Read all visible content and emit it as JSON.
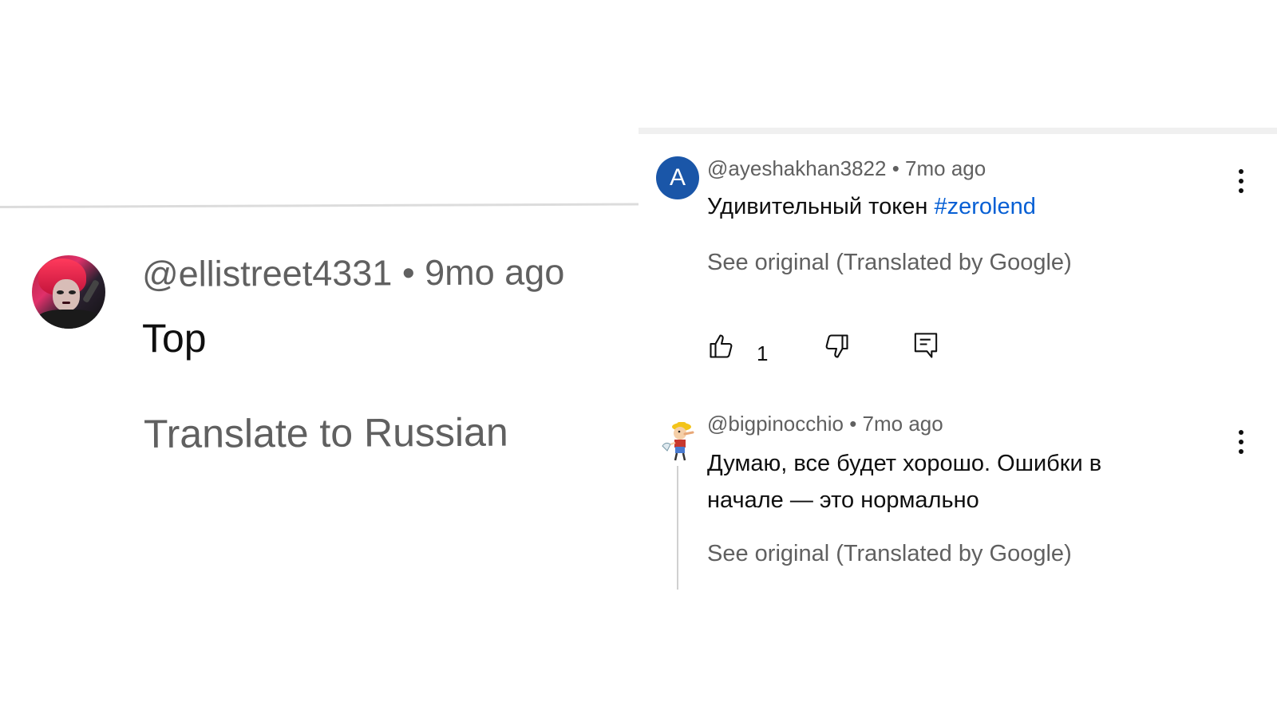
{
  "left_comment": {
    "handle": "@ellistreet4331",
    "separator": "•",
    "time": "9mo ago",
    "text": "Top",
    "translate_label": "Translate to Russian"
  },
  "right_comments": [
    {
      "avatar_letter": "A",
      "avatar_color": "#1a56a8",
      "handle": "@ayeshakhan3822",
      "separator": "•",
      "time": "7mo ago",
      "text": "Удивительный токен ",
      "hashtag": "#zerolend",
      "see_original": "See original (Translated by Google)",
      "like_count": "1"
    },
    {
      "handle": "@bigpinocchio",
      "separator": "•",
      "time": "7mo ago",
      "text_line1": "Думаю, все будет хорошо. Ошибки в",
      "text_line2": "начале — это нормально",
      "see_original": "See original (Translated by Google)"
    }
  ],
  "colors": {
    "meta_gray": "#606060",
    "text_black": "#0f0f0f",
    "hashtag_blue": "#065fd4"
  },
  "icons": [
    "thumbs-up-icon",
    "thumbs-down-icon",
    "reply-icon",
    "more-vert-icon"
  ]
}
